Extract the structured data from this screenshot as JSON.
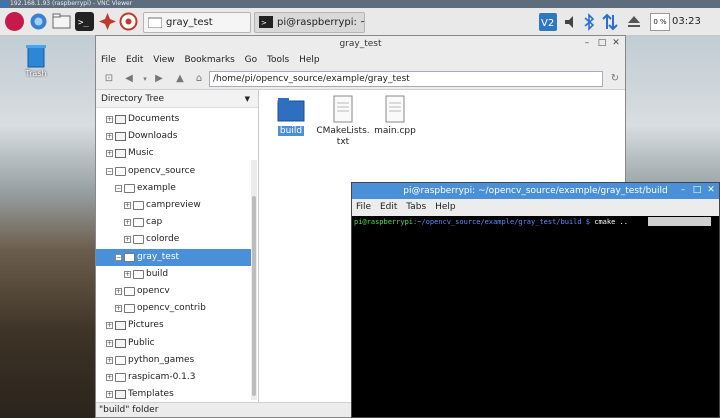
{
  "vnc": {
    "title": "192.168.1.93 (raspberrypi) - VNC Viewer"
  },
  "panel": {
    "tasks": [
      {
        "label": "gray_test"
      },
      {
        "label": "pi@raspberrypi: ~/op..."
      }
    ],
    "cpu_label": "0 %",
    "clock": "03:23"
  },
  "desktop": {
    "trash_label": "Trash"
  },
  "file_manager": {
    "title": "gray_test",
    "menu": [
      "File",
      "Edit",
      "View",
      "Bookmarks",
      "Go",
      "Tools",
      "Help"
    ],
    "path": "/home/pi/opencv_source/example/gray_test",
    "sidebar_header": "Directory Tree",
    "tree": [
      {
        "label": "Documents",
        "expander": "+",
        "icon": "documents-icon"
      },
      {
        "label": "Downloads",
        "expander": "+",
        "icon": "downloads-icon"
      },
      {
        "label": "Music",
        "expander": "+",
        "icon": "music-icon"
      },
      {
        "label": "opencv_source",
        "expander": "−",
        "icon": "folder-icon"
      },
      {
        "label": "example",
        "expander": "−",
        "icon": "folder-icon"
      },
      {
        "label": "campreview",
        "expander": "+",
        "icon": "folder-icon"
      },
      {
        "label": "cap",
        "expander": "+",
        "icon": "folder-icon"
      },
      {
        "label": "colorde",
        "expander": "+",
        "icon": "folder-icon"
      },
      {
        "label": "gray_test",
        "expander": "−",
        "icon": "folder-icon",
        "selected": true
      },
      {
        "label": "build",
        "expander": "+",
        "icon": "folder-icon"
      },
      {
        "label": "opencv",
        "expander": "+",
        "icon": "folder-icon"
      },
      {
        "label": "opencv_contrib",
        "expander": "+",
        "icon": "folder-icon"
      },
      {
        "label": "Pictures",
        "expander": "+",
        "icon": "pictures-icon"
      },
      {
        "label": "Public",
        "expander": "+",
        "icon": "public-icon"
      },
      {
        "label": "python_games",
        "expander": "+",
        "icon": "folder-icon"
      },
      {
        "label": "raspicam-0.1.3",
        "expander": "+",
        "icon": "folder-icon"
      },
      {
        "label": "Templates",
        "expander": "+",
        "icon": "templates-icon"
      }
    ],
    "files": [
      {
        "name": "build",
        "type": "folder",
        "selected": true
      },
      {
        "name": "CMakeLists.\ntxt",
        "type": "document"
      },
      {
        "name": "main.cpp",
        "type": "document"
      }
    ],
    "status": "\"build\" folder"
  },
  "terminal": {
    "title": "pi@raspberrypi: ~/opencv_source/example/gray_test/build",
    "menu": [
      "File",
      "Edit",
      "Tabs",
      "Help"
    ],
    "prompt_user": "pi@raspberrypi",
    "prompt_path": ":~/opencv_source/example/gray_test/build $",
    "command": " cmake .."
  },
  "colors": {
    "selection": "#4a90d9",
    "prompt_user": "#55e055",
    "prompt_path": "#5b8cff"
  }
}
